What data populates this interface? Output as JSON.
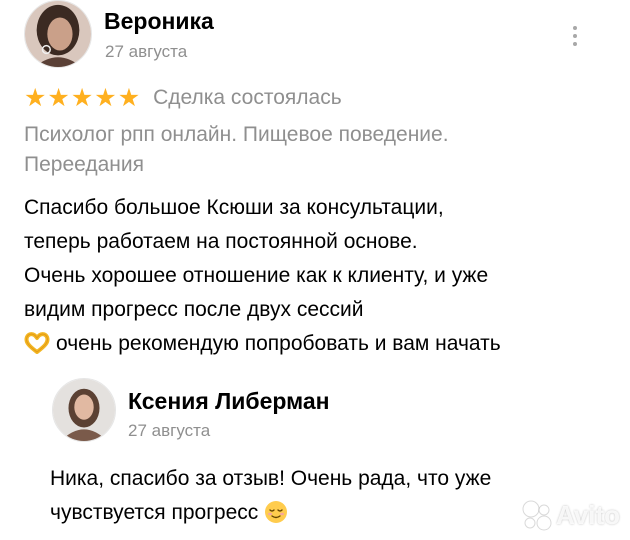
{
  "review": {
    "author": {
      "name": "Вероника",
      "avatar": "avatar-photo-woman"
    },
    "date": "27 августа",
    "rating": {
      "stars": 5,
      "max": 5,
      "star_color": "#ffb01f"
    },
    "deal_status": "Сделка состоялась",
    "service_lines": [
      "Психолог рпп онлайн. Пищевое поведение.",
      "Переедания"
    ],
    "text_lines": [
      "Спасибо большое Ксюши за консультации,",
      "теперь работаем на постоянной основе.",
      "Очень хорошее отношение как к клиенту, и уже",
      "видим прогресс после двух сессий",
      "очень рекомендую попробовать и вам начать"
    ],
    "text_emoji": "heart-hands-emoji"
  },
  "reply": {
    "author": {
      "name": "Ксения Либерман",
      "avatar": "avatar-photo-woman"
    },
    "date": "27 августа",
    "text_lines": [
      "Ника, спасибо за отзыв! Очень рада, что уже",
      "чувствуется прогресс"
    ],
    "text_emoji": "relieved-face-emoji"
  },
  "menu": {
    "icon": "more-vertical-icon"
  },
  "watermark": {
    "text": "Avito",
    "icon": "avito-logo-icon"
  },
  "colors": {
    "secondary_text": "#8f8f8f",
    "star": "#ffb01f"
  }
}
